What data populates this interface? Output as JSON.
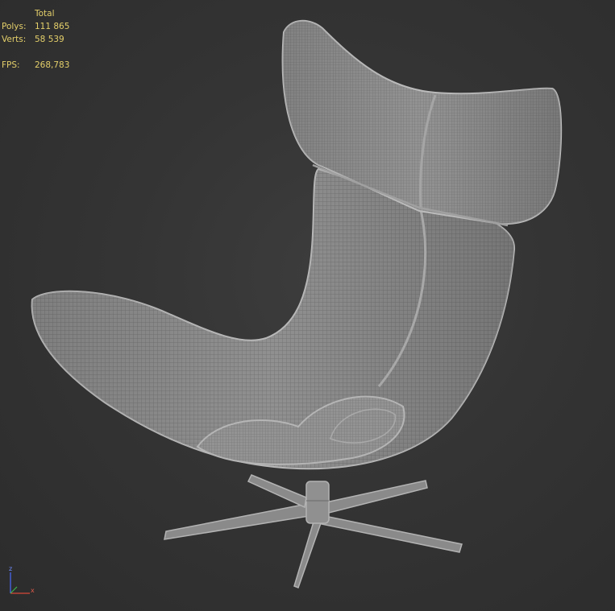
{
  "viewport": {
    "stats": {
      "header": "Total",
      "rows": [
        {
          "label": "Polys:",
          "value": "111 865"
        },
        {
          "label": "Verts:",
          "value": "58 539"
        }
      ],
      "fps": {
        "label": "FPS:",
        "value": "268,783"
      }
    },
    "gizmo": {
      "z_label": "z",
      "x_label": "x"
    },
    "colors": {
      "background": "#353535",
      "mesh_fill": "#8f8f8f",
      "wire": "#6c6c6c",
      "stats_text": "#e4cf6a",
      "axis_z": "#4a6cff",
      "axis_x": "#d84a3a"
    }
  }
}
